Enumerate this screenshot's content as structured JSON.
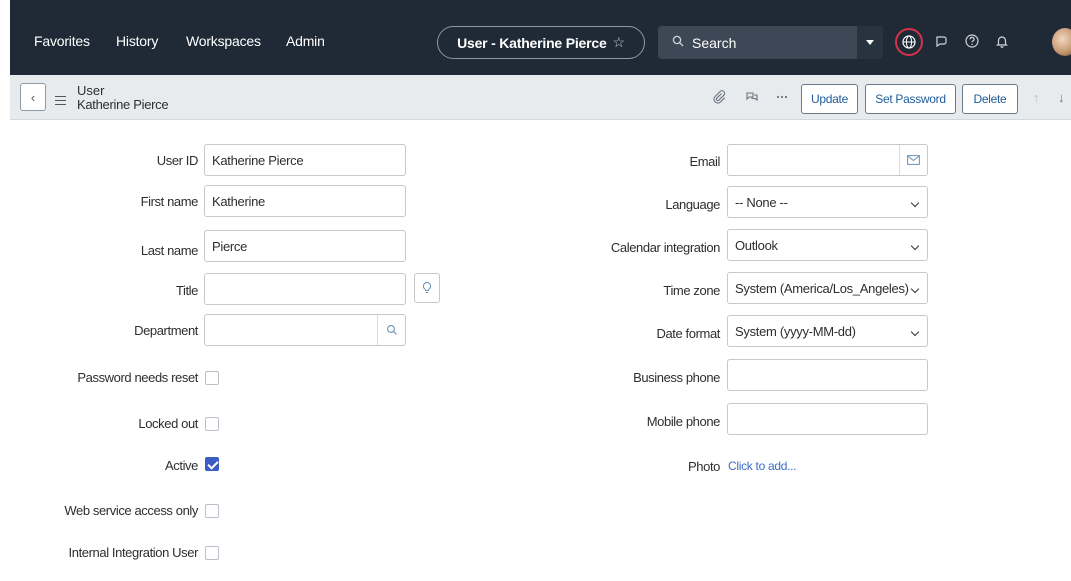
{
  "nav": {
    "items": [
      "Favorites",
      "History",
      "Workspaces",
      "Admin"
    ],
    "title_pill": "User - Katherine Pierce",
    "search_placeholder": "Search"
  },
  "record": {
    "table_label": "User",
    "name": "Katherine Pierce",
    "buttons": {
      "update": "Update",
      "set_password": "Set Password",
      "delete": "Delete"
    }
  },
  "form": {
    "left": {
      "user_id": {
        "label": "User ID",
        "value": "Katherine Pierce"
      },
      "first_name": {
        "label": "First name",
        "value": "Katherine"
      },
      "last_name": {
        "label": "Last name",
        "value": "Pierce"
      },
      "title": {
        "label": "Title",
        "value": ""
      },
      "department": {
        "label": "Department",
        "value": ""
      },
      "password_needs_reset": {
        "label": "Password needs reset",
        "checked": false
      },
      "locked_out": {
        "label": "Locked out",
        "checked": false
      },
      "active": {
        "label": "Active",
        "checked": true
      },
      "web_service_access_only": {
        "label": "Web service access only",
        "checked": false
      },
      "internal_integration_user": {
        "label": "Internal Integration User",
        "checked": false
      }
    },
    "right": {
      "email": {
        "label": "Email",
        "value": ""
      },
      "language": {
        "label": "Language",
        "value": "-- None --"
      },
      "calendar_integration": {
        "label": "Calendar integration",
        "value": "Outlook"
      },
      "time_zone": {
        "label": "Time zone",
        "value": "System (America/Los_Angeles)"
      },
      "date_format": {
        "label": "Date format",
        "value": "System (yyyy-MM-dd)"
      },
      "business_phone": {
        "label": "Business phone",
        "value": ""
      },
      "mobile_phone": {
        "label": "Mobile phone",
        "value": ""
      },
      "photo": {
        "label": "Photo",
        "link": "Click to add..."
      }
    }
  },
  "colors": {
    "topbar": "#1f2a36",
    "accent_link": "#3c6ec9",
    "highlight_ring": "#d3324a",
    "checkbox_active": "#3b5cc2"
  }
}
